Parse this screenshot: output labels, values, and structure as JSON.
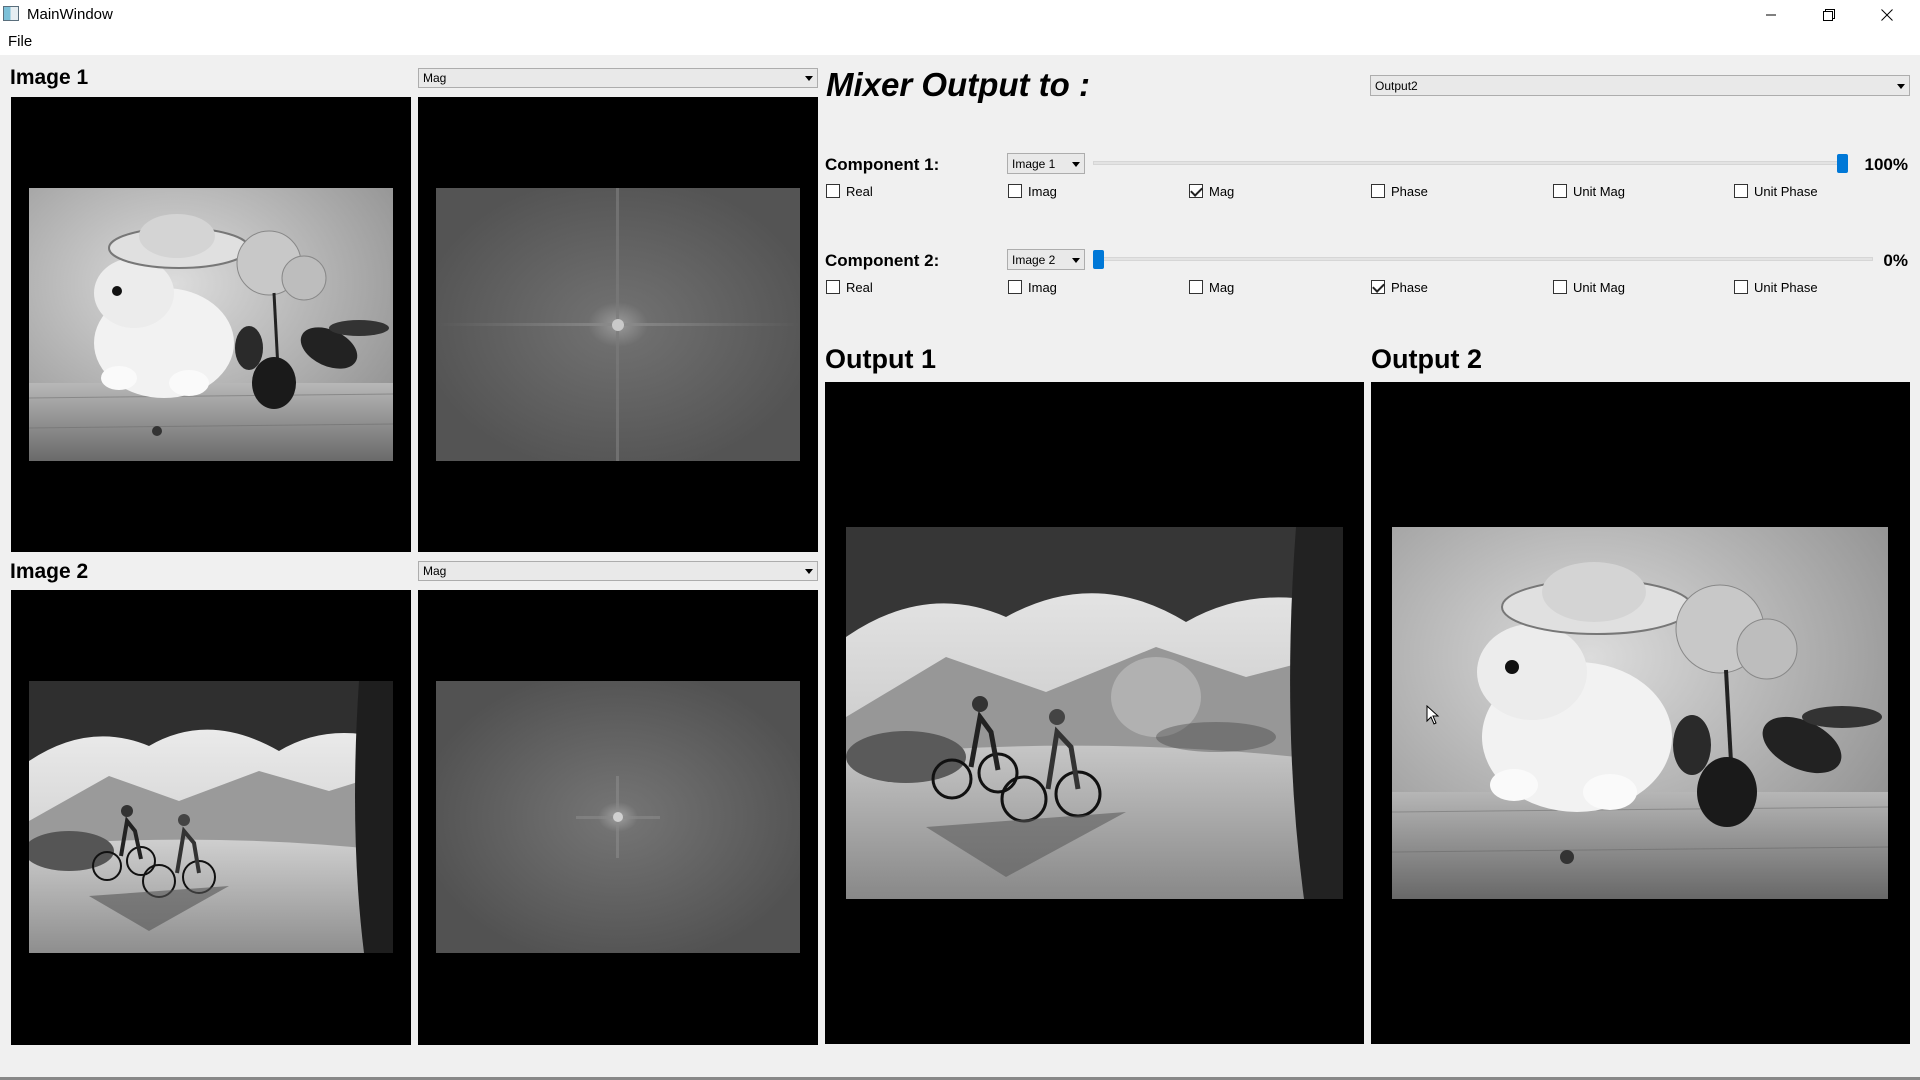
{
  "window": {
    "title": "MainWindow"
  },
  "menu": {
    "file": "File"
  },
  "inputs": [
    {
      "heading": "Image 1",
      "component_select": "Mag"
    },
    {
      "heading": "Image 2",
      "component_select": "Mag"
    }
  ],
  "mixer": {
    "heading": "Mixer Output to :",
    "output_select": "Output2",
    "components": [
      {
        "label": "Component 1:",
        "image_select": "Image 1",
        "weight_percent": 100,
        "weight_label": "100%",
        "checkboxes": [
          {
            "label": "Real",
            "checked": false
          },
          {
            "label": "Imag",
            "checked": false
          },
          {
            "label": "Mag",
            "checked": true
          },
          {
            "label": "Phase",
            "checked": false
          },
          {
            "label": "Unit Mag",
            "checked": false
          },
          {
            "label": "Unit Phase",
            "checked": false
          }
        ]
      },
      {
        "label": "Component 2:",
        "image_select": "Image 2",
        "weight_percent": 0,
        "weight_label": "0%",
        "checkboxes": [
          {
            "label": "Real",
            "checked": false
          },
          {
            "label": "Imag",
            "checked": false
          },
          {
            "label": "Mag",
            "checked": false
          },
          {
            "label": "Phase",
            "checked": true
          },
          {
            "label": "Unit Mag",
            "checked": false
          },
          {
            "label": "Unit Phase",
            "checked": false
          }
        ]
      }
    ]
  },
  "outputs": [
    {
      "heading": "Output 1"
    },
    {
      "heading": "Output 2"
    }
  ],
  "icons": {
    "app": "app-window-icon",
    "minimize": "minimize-icon",
    "maximize": "restore-icon",
    "close": "close-icon",
    "dropdown": "chevron-down-icon"
  },
  "colors": {
    "slider_handle": "#0078d7",
    "panel_background": "#000000",
    "window_background": "#f0f0f0"
  }
}
